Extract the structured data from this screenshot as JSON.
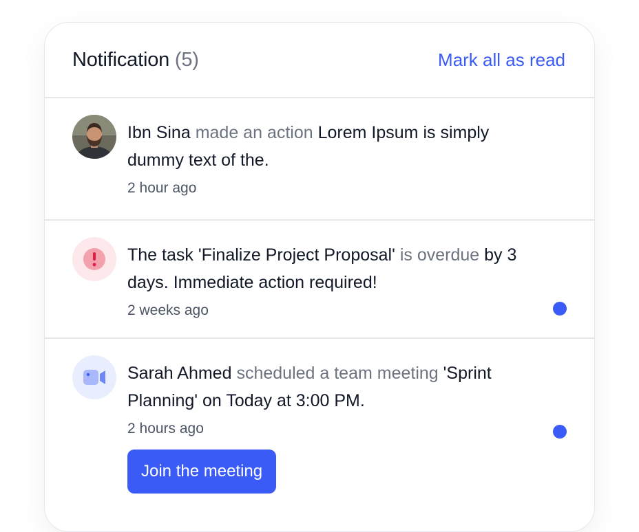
{
  "header": {
    "title": "Notification",
    "count": "(5)",
    "mark_all_label": "Mark all as read"
  },
  "notifications": [
    {
      "actor": "Ibn Sina",
      "action": "made an action",
      "text": "Lorem Ipsum is simply dummy text of the.",
      "time": "2 hour ago",
      "unread": false,
      "icon": "avatar-photo"
    },
    {
      "prefix": "The task 'Finalize Project Proposal'",
      "action": "is overdue",
      "text": "by 3 days. Immediate action required!",
      "time": "2 weeks ago",
      "unread": true,
      "icon": "alert-icon"
    },
    {
      "actor": "Sarah Ahmed",
      "action": "scheduled a team meeting",
      "text": "'Sprint Planning' on Today at 3:00 PM.",
      "time": "2 hours ago",
      "unread": true,
      "icon": "video-icon",
      "button_label": "Join the meeting"
    }
  ],
  "colors": {
    "accent": "#3b5bf6",
    "muted": "#6b7280",
    "alert": "#ef4444",
    "alert_bg": "#fde8ec",
    "video_bg": "#e8eefe"
  }
}
